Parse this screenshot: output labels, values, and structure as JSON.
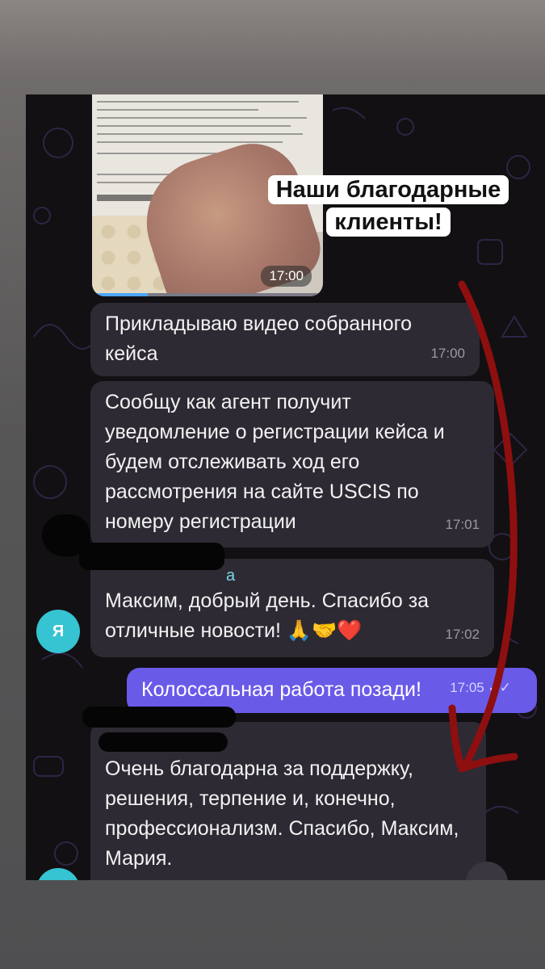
{
  "video": {
    "time": "17:00",
    "progress": 0.24
  },
  "caption": {
    "line1": "Наши благодарные",
    "line2": "клиенты!"
  },
  "messages": [
    {
      "text": "Прикладываю видео собранного кейса",
      "time": "17:00"
    },
    {
      "text": "Сообщу как агент получит уведомление о регистрации кейса и будем отслеживать ход его рассмотрения на сайте USCIS по номеру регистрации",
      "time": "17:01"
    },
    {
      "sender": "а",
      "text": "Максим, добрый день. Спасибо за отличные новости! 🙏🤝❤️",
      "time": "17:02",
      "avatar": "Я"
    },
    {
      "text": "Колоссальная работа позади!",
      "time": "17:05"
    },
    {
      "text": "Очень благодарна за поддержку, решения, терпение и, конечно, профессионализм. Спасибо, Максим, Мария."
    }
  ],
  "colors": {
    "incoming": "#2e2a33",
    "outgoing": "#6a5ae8",
    "arrow": "#8e0f0f",
    "avatar": "#36c3d2"
  }
}
